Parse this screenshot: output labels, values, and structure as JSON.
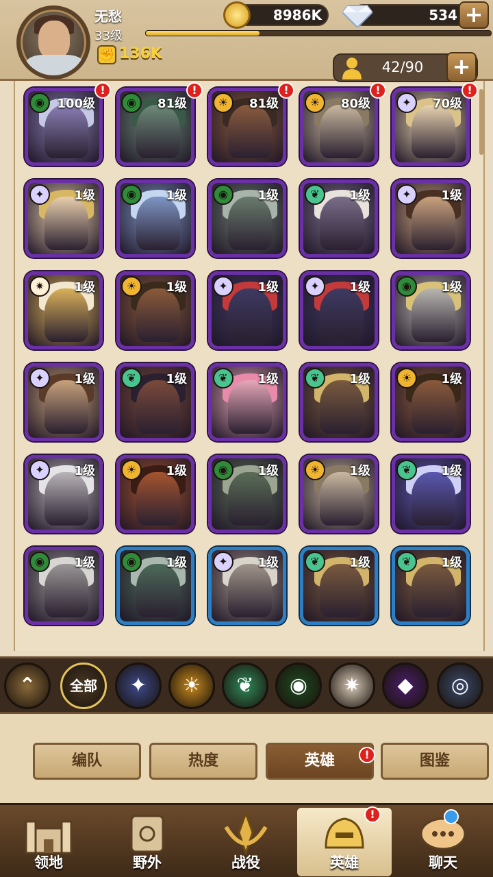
{
  "player": {
    "name": "无愁",
    "level": "33级",
    "power": "136K",
    "exp_fraction": 0.33
  },
  "resources": {
    "gold": "8986K",
    "gems": "534",
    "gem_plus": "+"
  },
  "hero_count": {
    "value": "42/90",
    "plus": "+"
  },
  "colors": {
    "legendary_purple": "#6b2fa8",
    "rare_blue": "#2c7fc4",
    "alert_red": "#e0201b",
    "exp_gold": "#e0a71e"
  },
  "factions": {
    "lightbearer": {
      "icon": "star-compass-icon",
      "color": "#d9d2ff"
    },
    "mauler": {
      "icon": "sun-fist-icon",
      "color": "#f0b530"
    },
    "wilder": {
      "icon": "leaf-icon",
      "color": "#49c48e"
    },
    "graveborn": {
      "icon": "green-eye-icon",
      "color": "#2f8a3a"
    },
    "celestial": {
      "icon": "white-star-icon",
      "color": "#fff1d6"
    },
    "hypogean": {
      "icon": "purple-diamond-icon",
      "color": "#8b34c8"
    },
    "dimensional": {
      "icon": "shield-disc-icon",
      "color": "#9bb7e0"
    }
  },
  "heroes": [
    {
      "level": "100级",
      "faction": "graveborn",
      "rarity": "purple",
      "alert": true,
      "hue": "#8a7fb5",
      "hair": "#c5c9e6"
    },
    {
      "level": "81级",
      "faction": "graveborn",
      "rarity": "purple",
      "alert": true,
      "hue": "#6d8a78",
      "hair": "#3a5a48"
    },
    {
      "level": "81级",
      "faction": "mauler",
      "rarity": "purple",
      "alert": true,
      "hue": "#8a5b3d",
      "hair": "#3b2a23"
    },
    {
      "level": "80级",
      "faction": "mauler",
      "rarity": "purple",
      "alert": true,
      "hue": "#c9b8a0",
      "hair": "#8a7a63"
    },
    {
      "level": "70级",
      "faction": "lightbearer",
      "rarity": "purple",
      "alert": true,
      "hue": "#e8d3b0",
      "hair": "#d9c38a"
    },
    {
      "level": "1级",
      "faction": "lightbearer",
      "rarity": "purple",
      "alert": false,
      "hue": "#e9cfae",
      "hair": "#d8b763"
    },
    {
      "level": "1级",
      "faction": "graveborn",
      "rarity": "purple",
      "alert": false,
      "hue": "#7e95c4",
      "hair": "#c5d6f0"
    },
    {
      "level": "1级",
      "faction": "graveborn",
      "rarity": "purple",
      "alert": false,
      "hue": "#6a7b6d",
      "hair": "#a8b3aa"
    },
    {
      "level": "1级",
      "faction": "wilder",
      "rarity": "purple",
      "alert": false,
      "hue": "#7a6e8a",
      "hair": "#e7e2dc"
    },
    {
      "level": "1级",
      "faction": "lightbearer",
      "rarity": "purple",
      "alert": false,
      "hue": "#c9a27d",
      "hair": "#4a3022"
    },
    {
      "level": "1级",
      "faction": "celestial",
      "rarity": "purple",
      "alert": false,
      "hue": "#d9b05a",
      "hair": "#f2e7cf"
    },
    {
      "level": "1级",
      "faction": "mauler",
      "rarity": "purple",
      "alert": false,
      "hue": "#8a5a3a",
      "hair": "#3a2a1c"
    },
    {
      "level": "1级",
      "faction": "lightbearer",
      "rarity": "purple",
      "alert": false,
      "hue": "#3e3a62",
      "hair": "#c43a3a"
    },
    {
      "level": "1级",
      "faction": "lightbearer",
      "rarity": "purple",
      "alert": false,
      "hue": "#3e3a62",
      "hair": "#c43a3a"
    },
    {
      "level": "1级",
      "faction": "graveborn",
      "rarity": "purple",
      "alert": false,
      "hue": "#b9b6b0",
      "hair": "#d8c27a"
    },
    {
      "level": "1级",
      "faction": "lightbearer",
      "rarity": "purple",
      "alert": false,
      "hue": "#c7a27b",
      "hair": "#5a3b28"
    },
    {
      "level": "1级",
      "faction": "wilder",
      "rarity": "purple",
      "alert": false,
      "hue": "#7a4a3b",
      "hair": "#2a2030"
    },
    {
      "level": "1级",
      "faction": "wilder",
      "rarity": "purple",
      "alert": false,
      "hue": "#e5a7b8",
      "hair": "#e88aa9"
    },
    {
      "level": "1级",
      "faction": "wilder",
      "rarity": "purple",
      "alert": false,
      "hue": "#7a5a3e",
      "hair": "#d2b56a"
    },
    {
      "level": "1级",
      "faction": "mauler",
      "rarity": "purple",
      "alert": false,
      "hue": "#8a5a3a",
      "hair": "#3a2818"
    },
    {
      "level": "1级",
      "faction": "lightbearer",
      "rarity": "purple",
      "alert": false,
      "hue": "#b9b4b8",
      "hair": "#e6e3e6"
    },
    {
      "level": "1级",
      "faction": "mauler",
      "rarity": "purple",
      "alert": false,
      "hue": "#a5542f",
      "hair": "#3a1c14"
    },
    {
      "level": "1级",
      "faction": "graveborn",
      "rarity": "purple",
      "alert": false,
      "hue": "#5a6d58",
      "hair": "#9ba592"
    },
    {
      "level": "1级",
      "faction": "mauler",
      "rarity": "purple",
      "alert": false,
      "hue": "#c9b8a0",
      "hair": "#8a7a63"
    },
    {
      "level": "1级",
      "faction": "wilder",
      "rarity": "purple",
      "alert": false,
      "hue": "#5a58b0",
      "hair": "#cfd0f6"
    },
    {
      "level": "1级",
      "faction": "graveborn",
      "rarity": "purple",
      "alert": false,
      "hue": "#9a9696",
      "hair": "#d8d6d2"
    },
    {
      "level": "1级",
      "faction": "graveborn",
      "rarity": "blue",
      "alert": false,
      "hue": "#4d6a5a",
      "hair": "#a8b8ae"
    },
    {
      "level": "1级",
      "faction": "lightbearer",
      "rarity": "blue",
      "alert": false,
      "hue": "#a0958a",
      "hair": "#d8d4cc"
    },
    {
      "level": "1级",
      "faction": "wilder",
      "rarity": "blue",
      "alert": false,
      "hue": "#7a5a3e",
      "hair": "#d2b56a"
    },
    {
      "level": "1级",
      "faction": "wilder",
      "rarity": "blue",
      "alert": false,
      "hue": "#7a5a3e",
      "hair": "#d2b56a"
    }
  ],
  "filters": [
    {
      "label": "",
      "name": "collapse-button",
      "icon": "double-chevron-up-icon",
      "color": "#8a6a3a"
    },
    {
      "label": "全部",
      "name": "filter-all",
      "icon": "",
      "color": "#4a3a25"
    },
    {
      "label": "",
      "name": "filter-lightbearer",
      "icon": "star-compass-icon",
      "color": "#3c4a8a"
    },
    {
      "label": "",
      "name": "filter-mauler",
      "icon": "sun-fist-icon",
      "color": "#c78a1e"
    },
    {
      "label": "",
      "name": "filter-wilder",
      "icon": "leaf-icon",
      "color": "#2f8a5a"
    },
    {
      "label": "",
      "name": "filter-graveborn",
      "icon": "green-eye-icon",
      "color": "#1f4a22"
    },
    {
      "label": "",
      "name": "filter-celestial",
      "icon": "white-star-icon",
      "color": "#d8cbb8"
    },
    {
      "label": "",
      "name": "filter-hypogean",
      "icon": "purple-diamond-icon",
      "color": "#4a1f6a"
    },
    {
      "label": "",
      "name": "filter-dimensional",
      "icon": "shield-disc-icon",
      "color": "#3a4a6a"
    }
  ],
  "subtabs": [
    {
      "label": "编队",
      "active": false
    },
    {
      "label": "热度",
      "active": false
    },
    {
      "label": "英雄",
      "active": true,
      "alert": true
    },
    {
      "label": "图鉴",
      "active": false
    }
  ],
  "nav": [
    {
      "label": "领地",
      "icon": "castle-icon",
      "active": false
    },
    {
      "label": "野外",
      "icon": "scroll-map-icon",
      "active": false
    },
    {
      "label": "战役",
      "icon": "crossed-swords-icon",
      "active": false
    },
    {
      "label": "英雄",
      "icon": "helmet-icon",
      "active": true,
      "alert": true
    },
    {
      "label": "聊天",
      "icon": "chat-icon",
      "active": false,
      "dot": true
    }
  ],
  "alert_mark": "!"
}
